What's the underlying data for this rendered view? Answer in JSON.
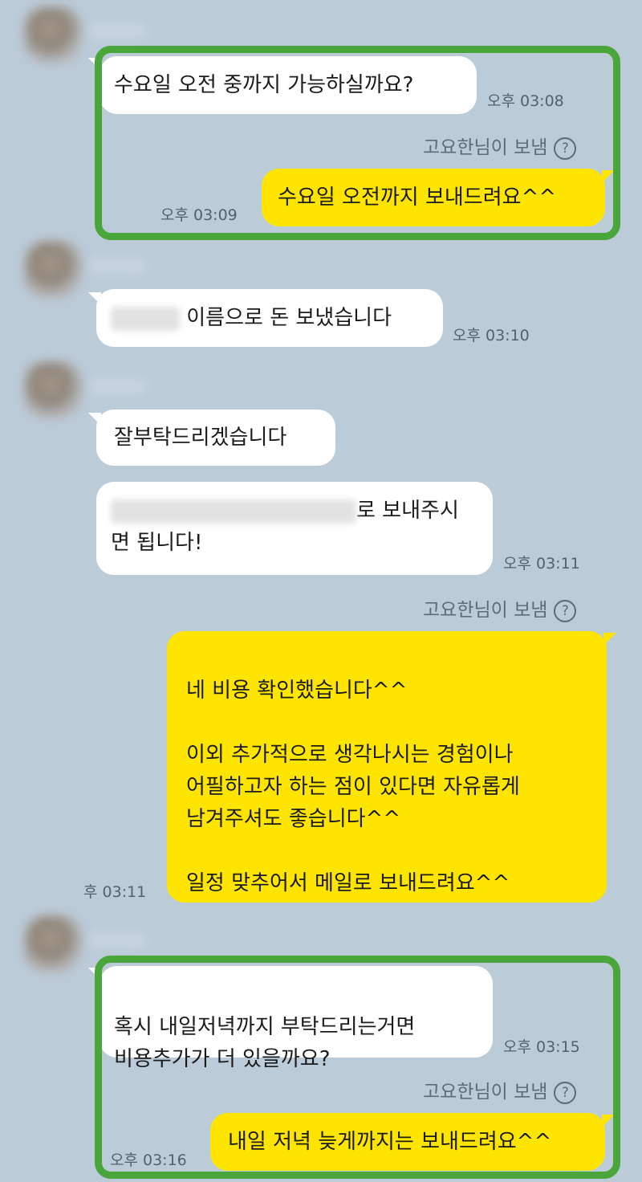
{
  "chat": {
    "m1": {
      "text": "수요일 오전 중까지 가능하실까요?",
      "time": "오후 03:08"
    },
    "sender1": "고요한님이 보냄",
    "help_glyph": "?",
    "m2": {
      "text": "수요일 오전까지 보내드려요^^",
      "time": "오후 03:09"
    },
    "m3": {
      "text": "이름으로 돈 보냈습니다",
      "time": "오후 03:10"
    },
    "m4": {
      "text": "잘부탁드리겠습니다"
    },
    "m5": {
      "text_line1_suffix": "로 보내주시",
      "text_line2": "면 됩니다!",
      "time": "오후 03:11"
    },
    "sender2": "고요한님이 보냄",
    "m6": {
      "text": "네 비용 확인했습니다^^\n\n이외 추가적으로 생각나시는 경험이나\n어필하고자 하는 점이 있다면 자유롭게\n남겨주셔도 좋습니다^^\n\n일정 맞추어서 메일로 보내드려요^^",
      "time": "후 03:11"
    },
    "m7": {
      "text": "혹시 내일저녁까지 부탁드리는거면\n비용추가가 더 있을까요?",
      "time": "오후 03:15"
    },
    "sender3": "고요한님이 보냄",
    "m8": {
      "text": "내일 저녁 늦게까지는 보내드려요^^",
      "time": "오후 03:16"
    }
  },
  "colors": {
    "background": "#bccbd8",
    "incoming_bubble": "#ffffff",
    "outgoing_bubble": "#fee500",
    "highlight_box": "#4aa63a"
  }
}
